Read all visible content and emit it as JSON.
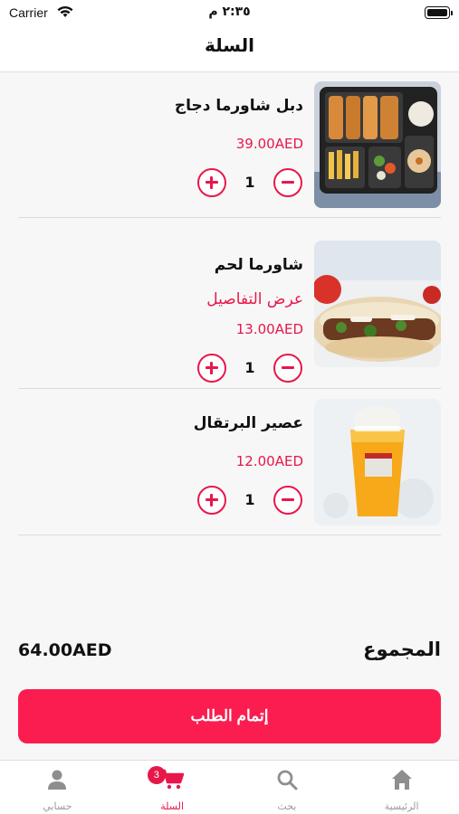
{
  "status_bar": {
    "carrier": "Carrier",
    "time": "٢:٣٥ م"
  },
  "nav": {
    "title": "السلة"
  },
  "cart": {
    "items": [
      {
        "name": "دبل شاورما دجاج",
        "price": "39.00AED",
        "quantity": "1",
        "image": "chicken-shawarma-platter-photo"
      },
      {
        "name": "شاورما لحم",
        "details_link": "عرض التفاصيل",
        "price": "13.00AED",
        "quantity": "1",
        "image": "meat-shawarma-wrap-photo"
      },
      {
        "name": "عصير البرتقال",
        "price": "12.00AED",
        "quantity": "1",
        "image": "orange-juice-cup-photo"
      }
    ]
  },
  "summary": {
    "total_label": "المجموع",
    "total_value": "64.00AED"
  },
  "checkout": {
    "label": "إتمام الطلب"
  },
  "tab_bar": {
    "tabs": [
      {
        "label": "الرئيسية",
        "icon": "home-icon",
        "active": false
      },
      {
        "label": "بحث",
        "icon": "search-icon",
        "active": false
      },
      {
        "label": "السلة",
        "icon": "cart-icon",
        "active": true,
        "badge": "3"
      },
      {
        "label": "حسابي",
        "icon": "user-icon",
        "active": false
      }
    ]
  },
  "colors": {
    "accent": "#e8174a",
    "button": "#fb1d4f",
    "background": "#f7f7f7"
  }
}
